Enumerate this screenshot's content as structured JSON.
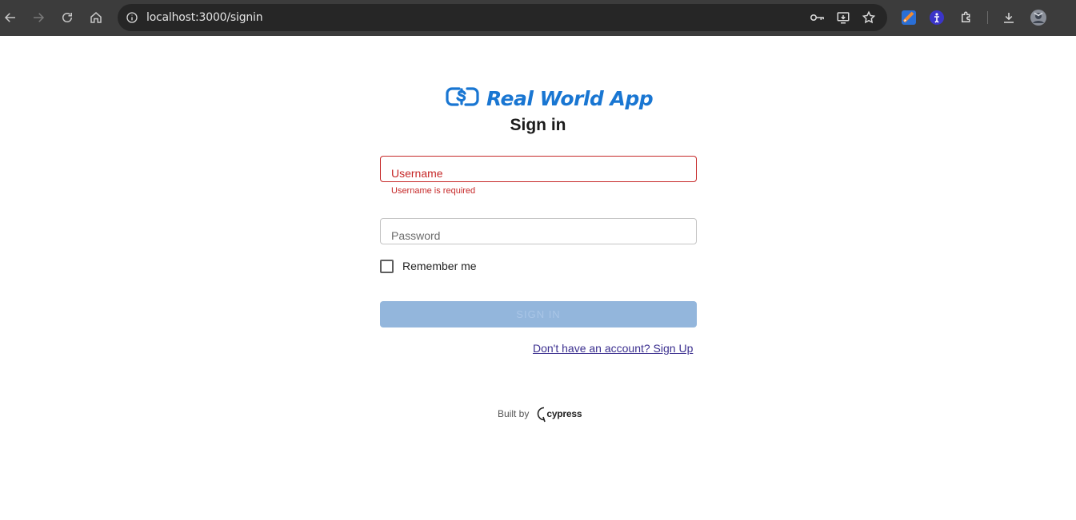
{
  "browser": {
    "url": "localhost:3000/signin",
    "icons": [
      "back-arrow-icon",
      "forward-arrow-icon",
      "reload-icon",
      "home-icon",
      "info-icon",
      "key-icon",
      "install-app-icon",
      "star-icon",
      "extension-1-icon",
      "extension-2-icon",
      "puzzle-icon",
      "download-icon",
      "profile-avatar"
    ]
  },
  "app": {
    "brand": "Real World App",
    "brand_color": "#1976d2",
    "title": "Sign in"
  },
  "form": {
    "username_placeholder": "Username",
    "username_error": "Username is required",
    "password_placeholder": "Password",
    "remember_label": "Remember me",
    "submit_label": "SIGN IN",
    "signup_link": "Don't have an account? Sign Up",
    "error_color": "#c62828"
  },
  "footer": {
    "built_by": "Built by",
    "brand": "cypress"
  }
}
